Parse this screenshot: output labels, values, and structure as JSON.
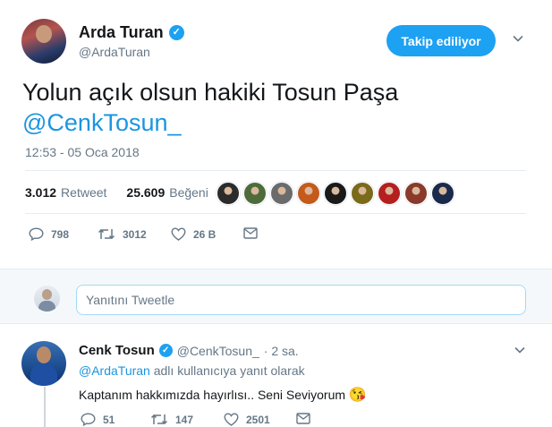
{
  "author": {
    "name": "Arda Turan",
    "handle": "@ArdaTuran",
    "follow_label": "Takip ediliyor"
  },
  "tweet": {
    "text_line1": "Yolun açık olsun hakiki Tosun Paşa",
    "mention": "@CenkTosun_",
    "timestamp": "12:53 - 05 Oca 2018",
    "retweet_count": "3.012",
    "retweet_label": "Retweet",
    "like_count": "25.609",
    "like_label": "Beğeni",
    "actions": {
      "reply_count": "798",
      "retweet_count": "3012",
      "like_count": "26 B"
    }
  },
  "likers": [
    {
      "color": "#2b2b2b",
      "icon": "avatar"
    },
    {
      "color": "#4e6b3a",
      "icon": "avatar"
    },
    {
      "color": "#6b6b6b",
      "icon": "avatar"
    },
    {
      "color": "#c45a1c",
      "icon": "avatar"
    },
    {
      "color": "#1a1a1a",
      "icon": "avatar"
    },
    {
      "color": "#7a6a1a",
      "icon": "avatar"
    },
    {
      "color": "#b51f1f",
      "icon": "avatar"
    },
    {
      "color": "#8a3a2a",
      "icon": "avatar"
    },
    {
      "color": "#1a2a4a",
      "icon": "avatar"
    }
  ],
  "reply_box": {
    "placeholder": "Yanıtını Tweetle"
  },
  "reply": {
    "name": "Cenk Tosun",
    "handle": "@CenkTosun_",
    "time": "· 2 sa.",
    "mention": "@ArdaTuran",
    "reply_to_suffix": " adlı kullanıcıya yanıt olarak",
    "text": "Kaptanım hakkımızda hayırlısı.. Seni Seviyorum ",
    "emoji": "😘",
    "actions": {
      "reply_count": "51",
      "retweet_count": "147",
      "like_count": "2501"
    }
  },
  "colors": {
    "accent": "#1da1f2",
    "link": "#1b95e0",
    "muted": "#657786"
  }
}
